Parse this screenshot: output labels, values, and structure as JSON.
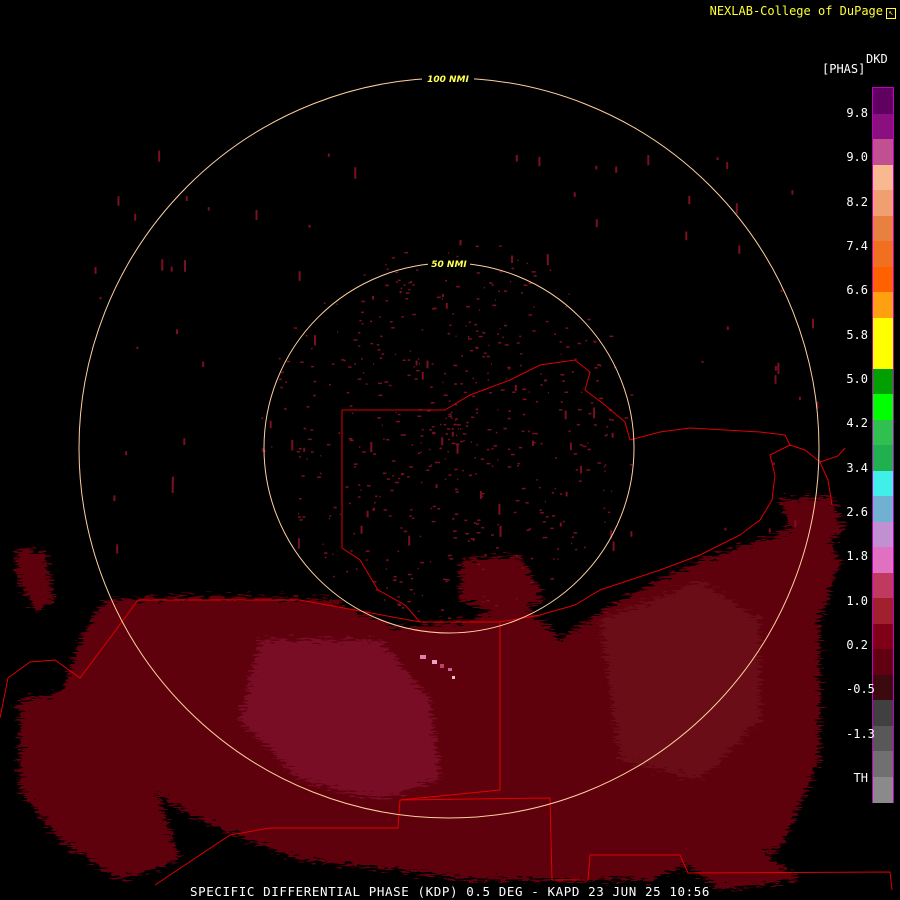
{
  "header": {
    "credit": "NEXLAB-College of DuPage"
  },
  "legend": {
    "product": "DKD",
    "unit": "[PHAS]",
    "ticks": [
      "9.8",
      "9.0",
      "8.2",
      "7.4",
      "6.6",
      "5.8",
      "5.0",
      "4.2",
      "3.4",
      "2.6",
      "1.8",
      "1.0",
      "0.2",
      "-0.5",
      "-1.3",
      "TH"
    ],
    "colors": [
      "#600060",
      "#8a1080",
      "#c05090",
      "#f8b890",
      "#f0a070",
      "#e88040",
      "#f07020",
      "#ff6000",
      "#ffa010",
      "#ffff00",
      "#ffff00",
      "#00a000",
      "#00ff00",
      "#30c050",
      "#20b050",
      "#40f0e8",
      "#70b0d0",
      "#c090d0",
      "#e070c0",
      "#c03a60",
      "#a0202e",
      "#800018",
      "#600010",
      "#3a0a0e",
      "#404040",
      "#585858",
      "#707070",
      "#8a8a8a"
    ]
  },
  "rings": [
    {
      "label": "50 NMI"
    },
    {
      "label": "100 NMI"
    }
  ],
  "footer": {
    "caption": "SPECIFIC DIFFERENTIAL PHASE (KDP) 0.5 DEG - KAPD 23 JUN 25 10:56"
  }
}
